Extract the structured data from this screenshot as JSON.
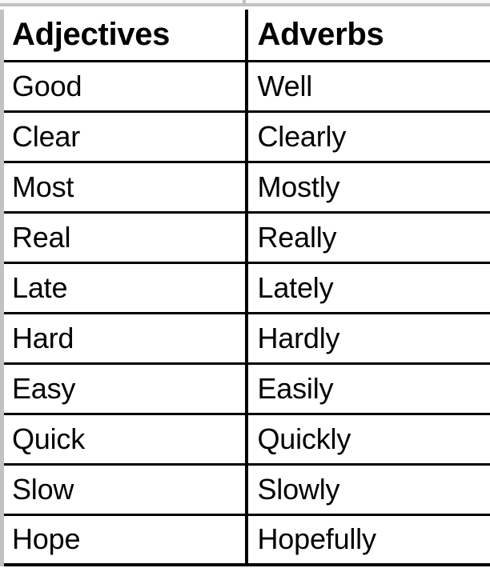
{
  "document": {
    "type": "two-column reference table",
    "top_partial_row_visible": true,
    "colors": {
      "text": "#000000",
      "page_background": "#ffffff",
      "grid_black": "#000000",
      "grid_gray": "#c2c2c2",
      "cutoff_row_fill": "#f7f8f9"
    }
  },
  "table": {
    "columns": [
      {
        "key": "adjectives",
        "header": "Adjectives"
      },
      {
        "key": "adverbs",
        "header": "Adverbs"
      }
    ],
    "rows": [
      {
        "adjective": "Good",
        "adverb": "Well"
      },
      {
        "adjective": "Clear",
        "adverb": "Clearly"
      },
      {
        "adjective": "Most",
        "adverb": "Mostly"
      },
      {
        "adjective": "Real",
        "adverb": "Really"
      },
      {
        "adjective": "Late",
        "adverb": "Lately"
      },
      {
        "adjective": "Hard",
        "adverb": "Hardly"
      },
      {
        "adjective": "Easy",
        "adverb": "Easily"
      },
      {
        "adjective": "Quick",
        "adverb": "Quickly"
      },
      {
        "adjective": "Slow",
        "adverb": "Slowly"
      },
      {
        "adjective": "Hope",
        "adverb": "Hopefully"
      }
    ],
    "row_count": 10
  }
}
